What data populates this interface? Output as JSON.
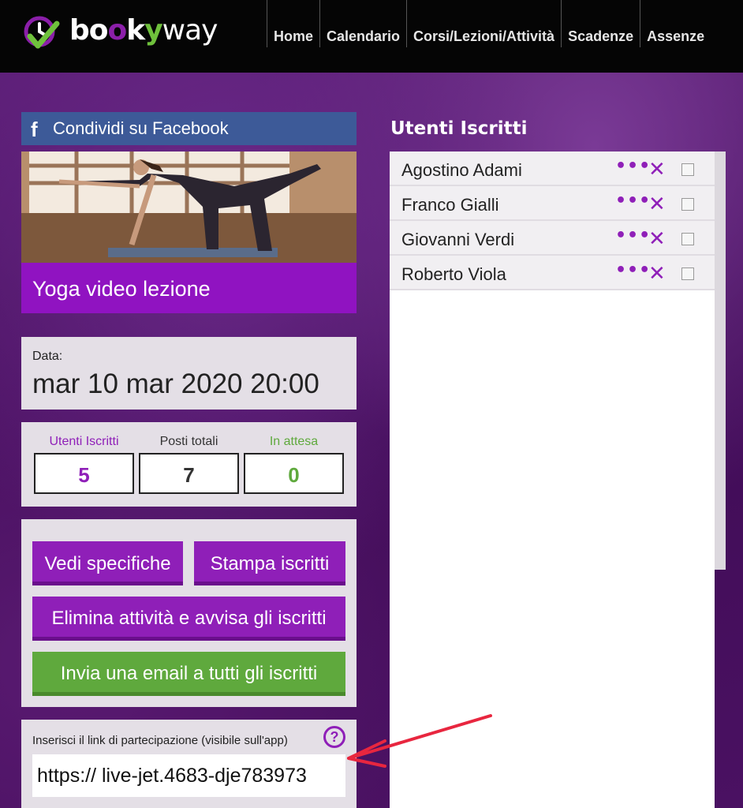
{
  "app": {
    "logo_text_b": "b",
    "logo_text_o1": "o",
    "logo_text_o2": "o",
    "logo_text_k": "k",
    "logo_text_y": "y",
    "logo_text_way": "way"
  },
  "nav": {
    "items": [
      {
        "label": "Home"
      },
      {
        "label": "Calendario"
      },
      {
        "label": "Corsi/Lezioni/Attività"
      },
      {
        "label": "Scadenze"
      },
      {
        "label": "Assenze"
      }
    ]
  },
  "share": {
    "icon": "facebook-icon",
    "label": "Condividi su Facebook"
  },
  "lesson": {
    "title": "Yoga video lezione"
  },
  "date": {
    "label": "Data:",
    "value": "mar 10 mar 2020 20:00"
  },
  "stats": {
    "enrolled_label": "Utenti Iscritti",
    "enrolled_value": "5",
    "total_label": "Posti totali",
    "total_value": "7",
    "waiting_label": "In attesa",
    "waiting_value": "0"
  },
  "actions": {
    "specs_label": "Vedi specifiche",
    "print_label": "Stampa iscritti",
    "delete_label": "Elimina attività e avvisa gli iscritti",
    "email_label": "Invia una email a tutti gli iscritti"
  },
  "link": {
    "label": "Inserisci il link di partecipazione (visibile sull'app)",
    "help": "?",
    "value": "https:// live-jet.4683-dje783973"
  },
  "users": {
    "title": "Utenti Iscritti",
    "more_glyph": "•••",
    "remove_glyph": "✕",
    "items": [
      {
        "name": "Agostino Adami"
      },
      {
        "name": "Franco Gialli"
      },
      {
        "name": "Giovanni Verdi"
      },
      {
        "name": "Roberto Viola"
      }
    ]
  },
  "colors": {
    "brand_purple": "#8f1fb8",
    "brand_green": "#5fa93d",
    "facebook_blue": "#3d5a98"
  }
}
